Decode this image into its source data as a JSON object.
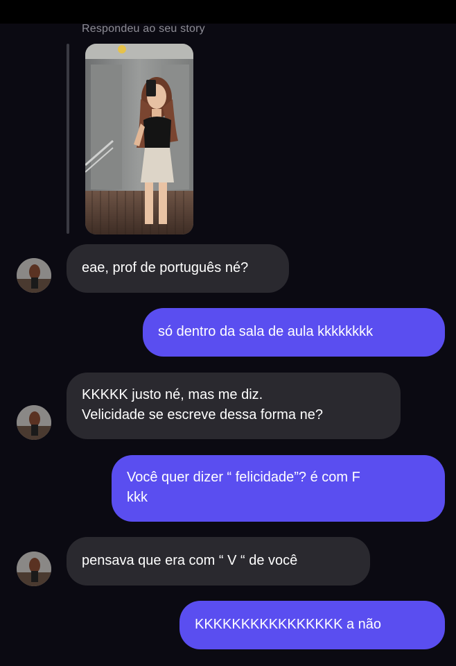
{
  "story_reply": {
    "caption": "Respondeu ao seu story"
  },
  "messages": [
    {
      "from": "them",
      "lines": [
        "eae, prof de português né?"
      ]
    },
    {
      "from": "me",
      "lines": [
        "só dentro da sala de aula kkkkkkkk"
      ]
    },
    {
      "from": "them",
      "lines": [
        "KKKKK justo né, mas me diz.",
        "Velicidade se escreve dessa forma ne?"
      ]
    },
    {
      "from": "me",
      "lines": [
        "Você quer dizer “ felicidade”? é com F",
        "kkk"
      ]
    },
    {
      "from": "them",
      "lines": [
        "pensava que era com “ V “ de você"
      ]
    },
    {
      "from": "me",
      "lines": [
        "KKKKKKKKKKKKKKKK a não"
      ]
    }
  ],
  "colors": {
    "background": "#0b0a12",
    "received_bubble": "#2a292f",
    "sent_bubble": "#5a4ef0",
    "text": "#ffffff",
    "caption": "#8e8d96"
  }
}
